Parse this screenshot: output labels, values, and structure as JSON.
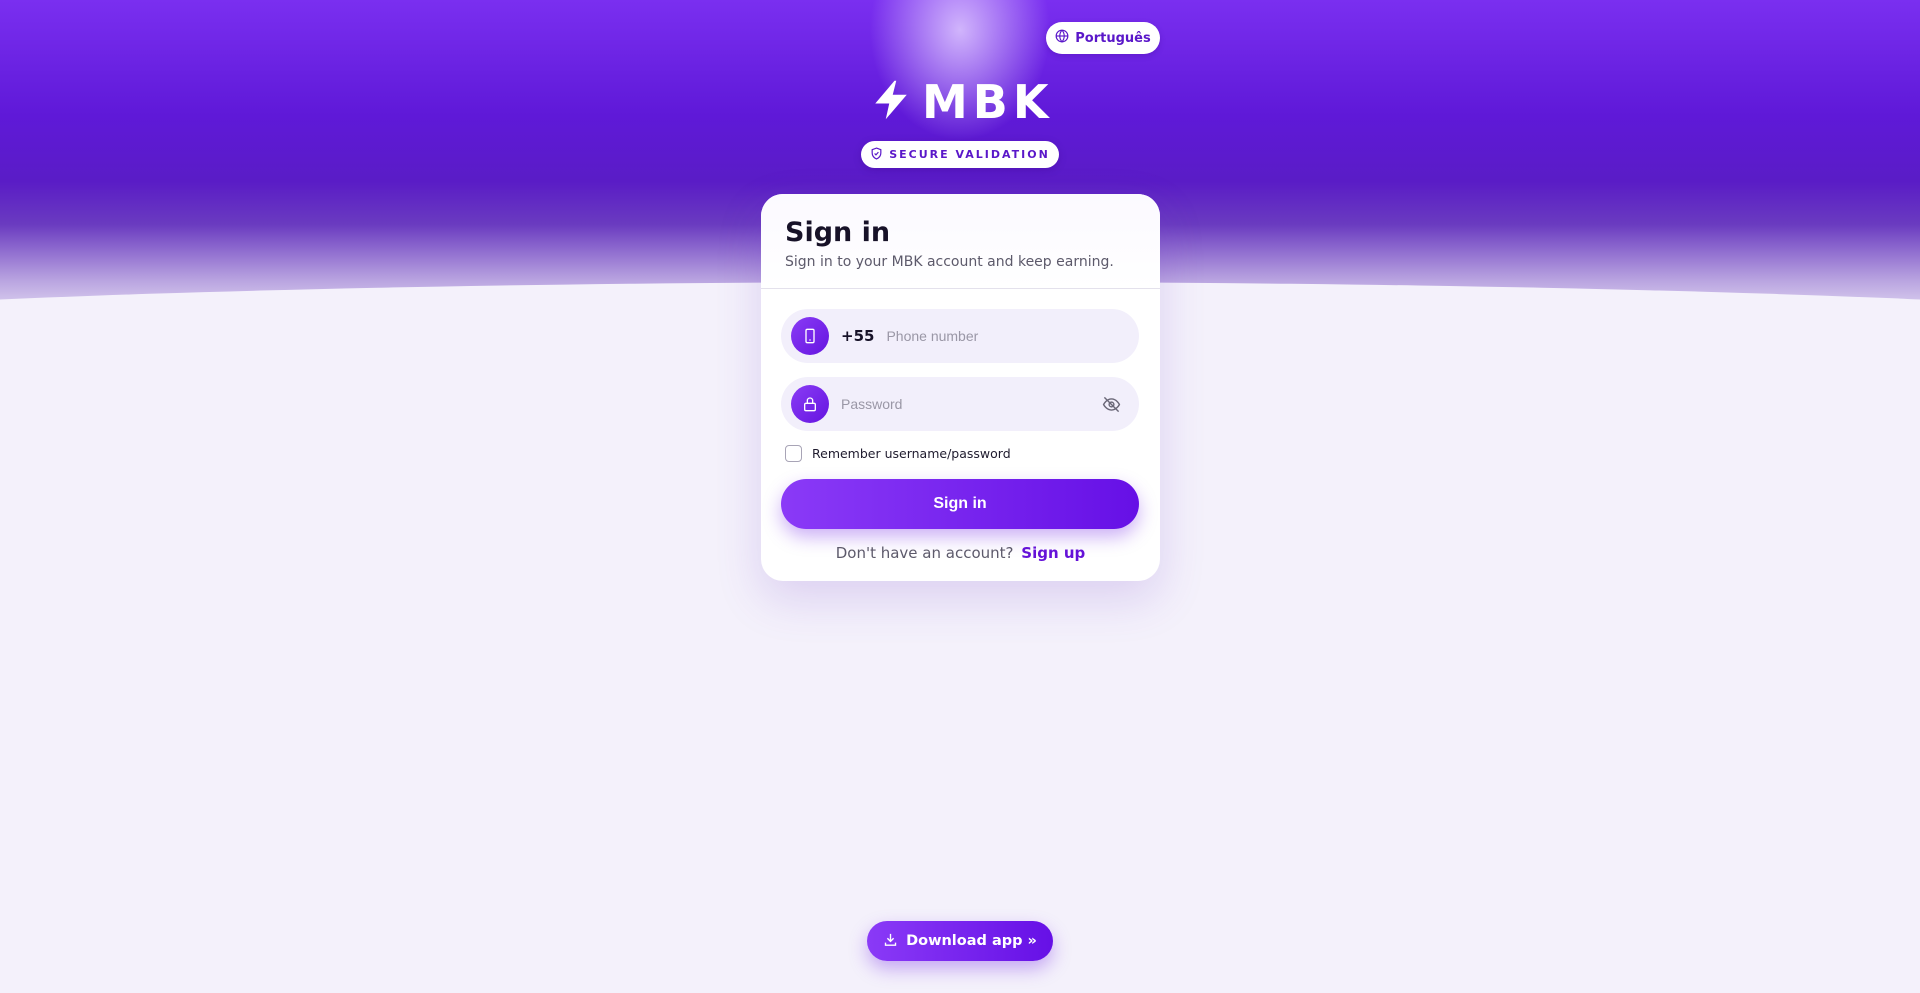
{
  "language": {
    "label": "Português",
    "icon": "globe-icon"
  },
  "brand": {
    "name": "MBK",
    "icon": "lightning-bolt-icon"
  },
  "badge": {
    "label": "SECURE VALIDATION",
    "icon": "shield-check-icon"
  },
  "card": {
    "title": "Sign in",
    "subtitle": "Sign in to your MBK account and keep earning."
  },
  "phone": {
    "icon": "smartphone-icon",
    "prefix": "+55",
    "placeholder": "Phone number",
    "value": ""
  },
  "password": {
    "icon": "lock-icon",
    "placeholder": "Password",
    "value": "",
    "toggle_icon": "eye-off-icon"
  },
  "remember": {
    "label": "Remember username/password",
    "checked": false
  },
  "signin": {
    "label": "Sign in"
  },
  "signup": {
    "prompt": "Don't have an account?",
    "link": "Sign up"
  },
  "download": {
    "label": "Download app »",
    "icon": "download-icon"
  },
  "colors": {
    "primary": "#6a14e6",
    "accent": "#8a3af7",
    "background": "#f4f1fb"
  }
}
